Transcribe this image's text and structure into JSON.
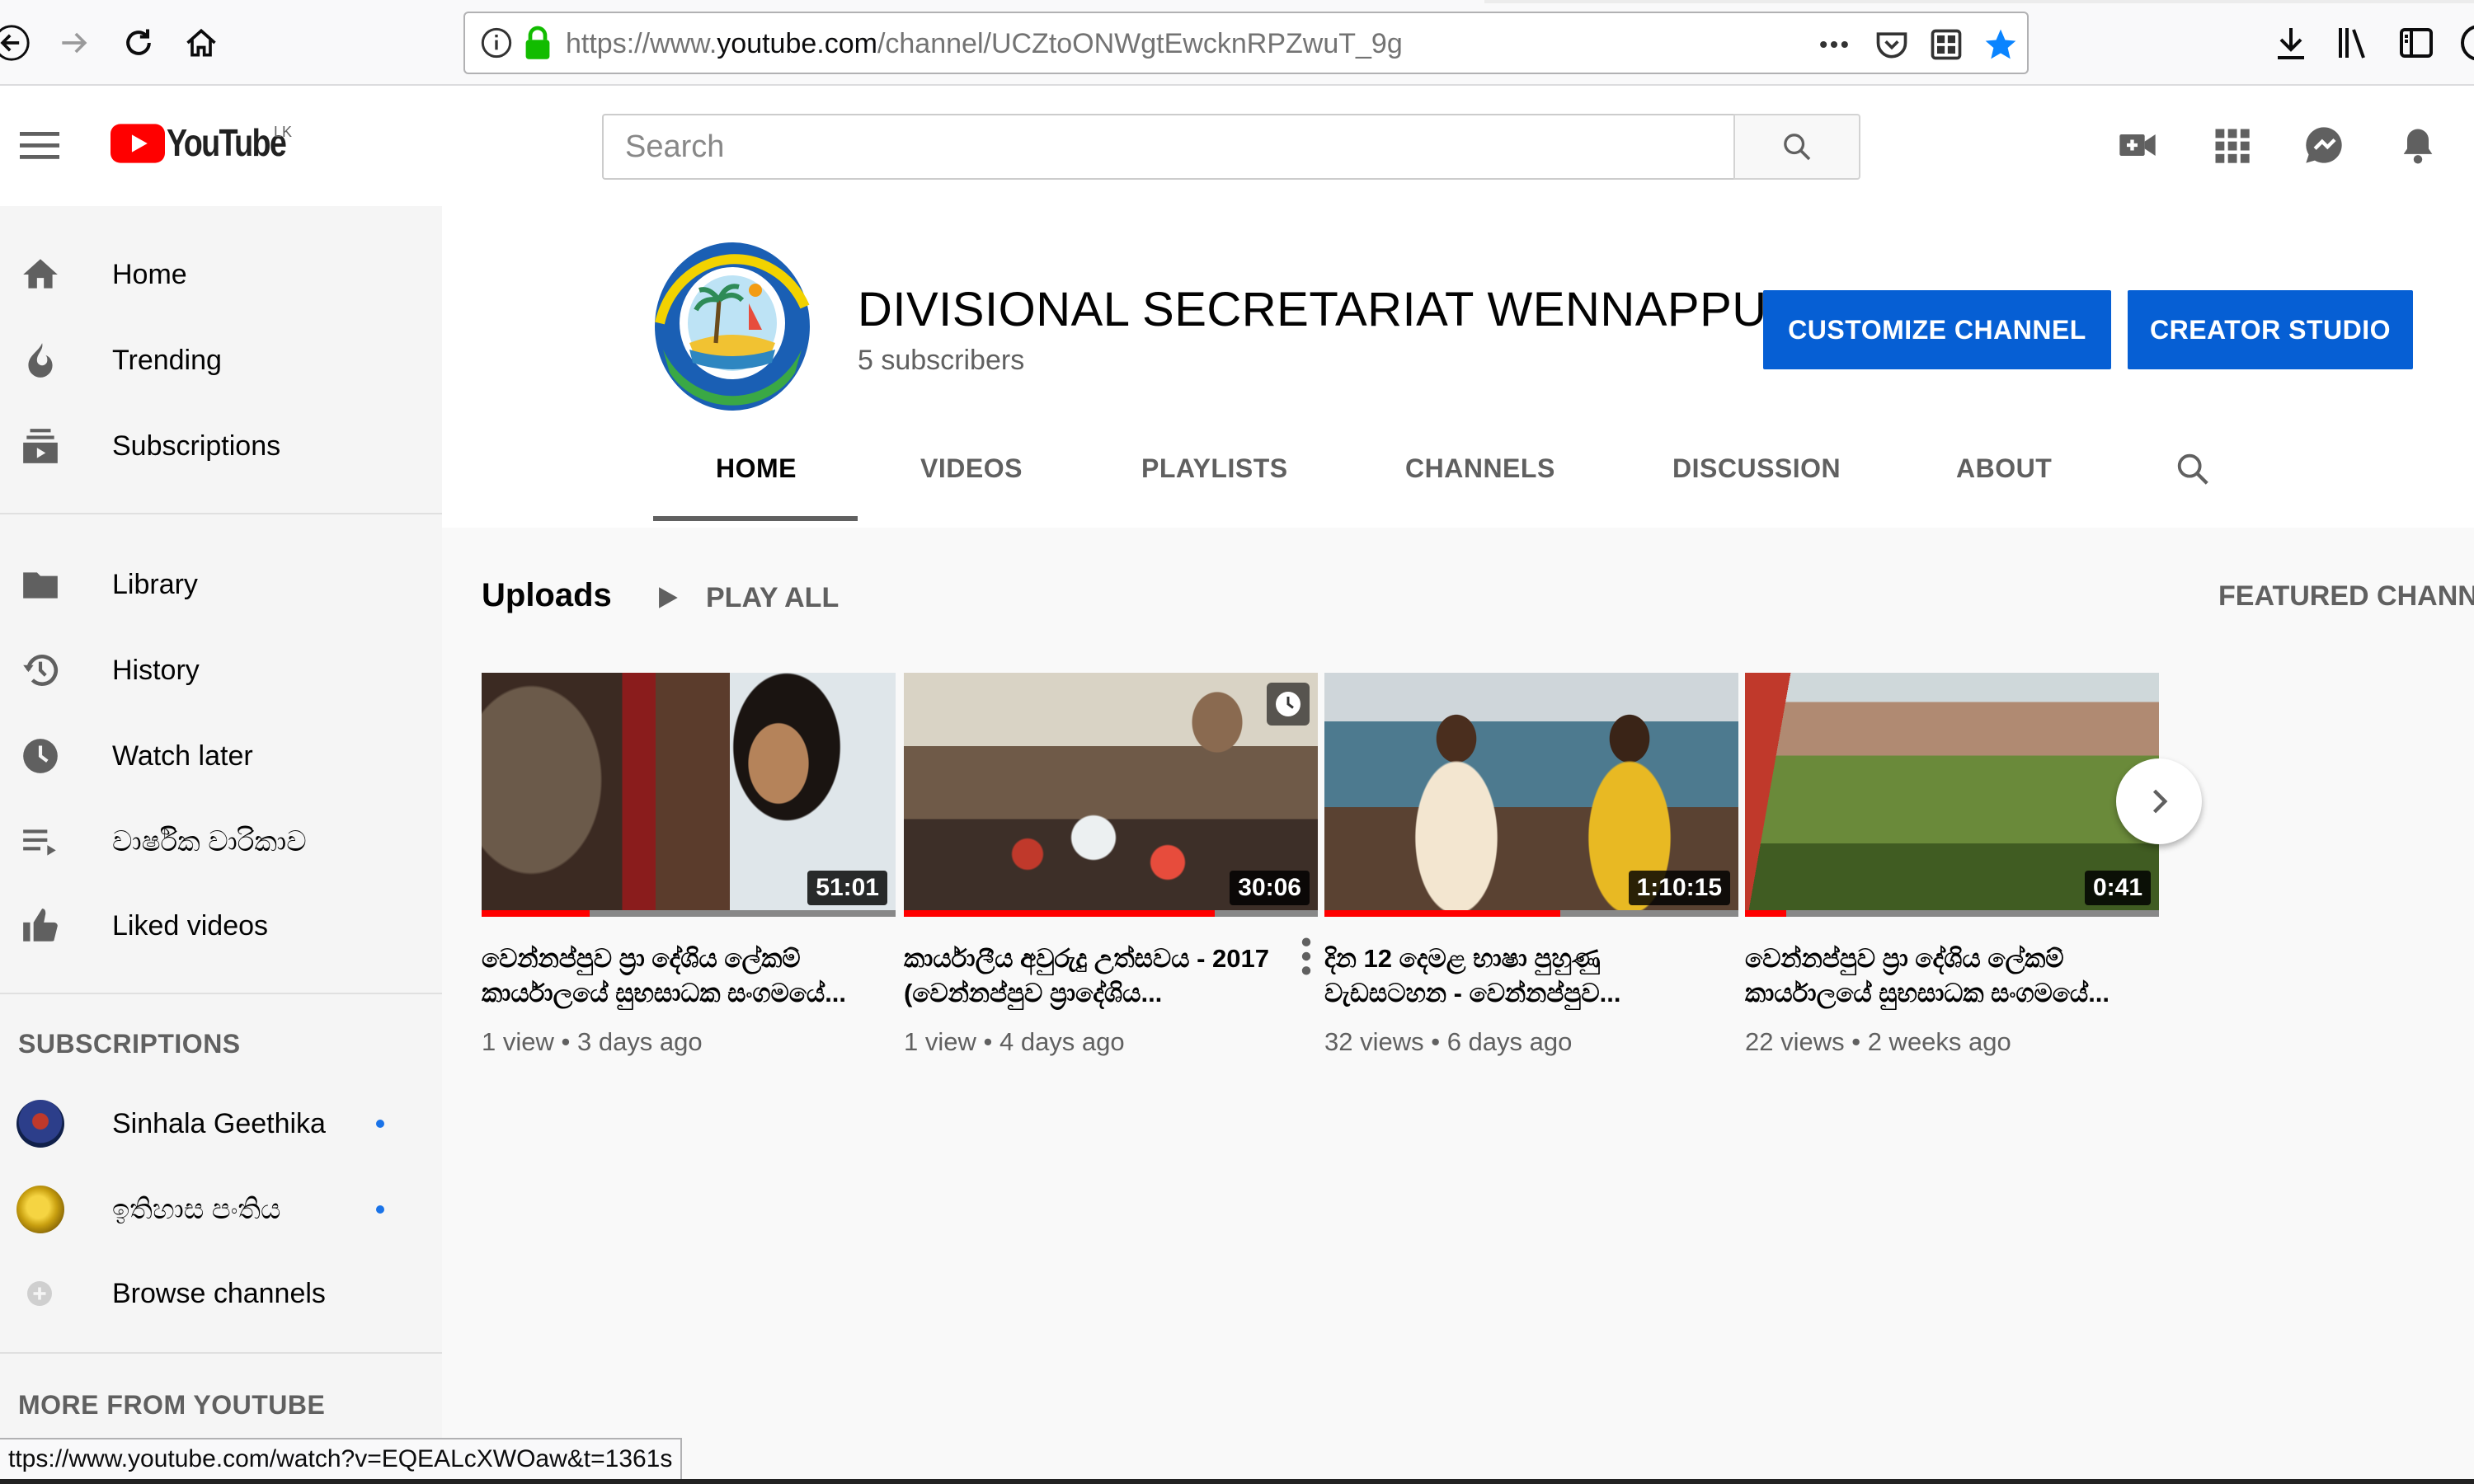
{
  "browser": {
    "url_prefix": "https://www.",
    "url_domain": "youtube.com",
    "url_path": "/channel/UCZtoONWgtEwcknRPZwuT_9g",
    "status_url": "ttps://www.youtube.com/watch?v=EQEALcXWOaw&t=1361s"
  },
  "masthead": {
    "logo_text": "YouTube",
    "country_code": "LK",
    "search_placeholder": "Search"
  },
  "sidebar": {
    "main": [
      {
        "label": "Home",
        "icon": "home-icon"
      },
      {
        "label": "Trending",
        "icon": "trending-icon"
      },
      {
        "label": "Subscriptions",
        "icon": "subscriptions-icon"
      }
    ],
    "library": [
      {
        "label": "Library",
        "icon": "library-icon"
      },
      {
        "label": "History",
        "icon": "history-icon"
      },
      {
        "label": "Watch later",
        "icon": "watch-later-icon"
      },
      {
        "label": "වාර්ෂික වාරිකාව",
        "icon": "playlist-icon"
      },
      {
        "label": "Liked videos",
        "icon": "thumbs-up-icon"
      }
    ],
    "subscriptions_heading": "SUBSCRIPTIONS",
    "subscriptions": [
      {
        "label": "Sinhala Geethika"
      },
      {
        "label": "ඉතිහාස පංතිය"
      }
    ],
    "browse_channels": "Browse channels",
    "more_heading": "MORE FROM YOUTUBE"
  },
  "channel": {
    "name": "DIVISIONAL SECRETARIAT WENNAPPUWA",
    "subscribers": "5 subscribers",
    "customize_button": "CUSTOMIZE CHANNEL",
    "studio_button": "CREATOR STUDIO",
    "tabs": [
      "HOME",
      "VIDEOS",
      "PLAYLISTS",
      "CHANNELS",
      "DISCUSSION",
      "ABOUT"
    ],
    "active_tab": "HOME"
  },
  "uploads": {
    "title": "Uploads",
    "play_all": "PLAY ALL",
    "featured_heading": "FEATURED CHANNEL",
    "videos": [
      {
        "title": "වෙන්නප්පුව ප්‍රා දේශිය ලේකම් කාර්යාලයේ සුභසාධක සංගමයේ...",
        "views": "1 view",
        "age": "3 days ago",
        "duration": "51:01",
        "watched_fraction": 0.26
      },
      {
        "title": "කාර්යාලීය අවුරුදු උත්සවය - 2017 (වෙන්නප්පුව ප්‍රාදේශිය...",
        "views": "1 view",
        "age": "4 days ago",
        "duration": "30:06",
        "watched_fraction": 0.75
      },
      {
        "title": "දින 12 දෙමළ භාෂා පුහුණු වැඩසටහන - වෙන්නප්පුව...",
        "views": "32 views",
        "age": "6 days ago",
        "duration": "1:10:15",
        "watched_fraction": 0.57
      },
      {
        "title": "වෙන්නප්පුව ප්‍රා දේශිය ලේකම් කාර්යාලයේ සුභසාධක සංගමයේ...",
        "views": "22 views",
        "age": "2 weeks ago",
        "duration": "0:41",
        "watched_fraction": 0.1
      }
    ]
  }
}
